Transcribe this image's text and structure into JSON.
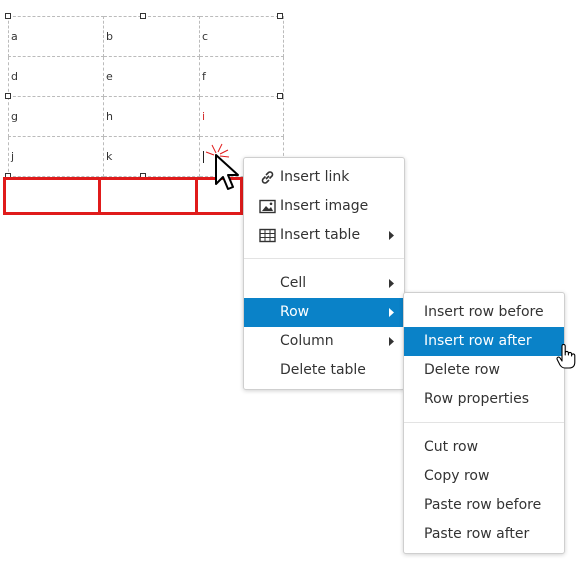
{
  "table": {
    "rows": [
      [
        "a",
        "b",
        "c"
      ],
      [
        "d",
        "e",
        "f"
      ],
      [
        "g",
        "h",
        "i"
      ],
      [
        "j",
        "k",
        ""
      ]
    ]
  },
  "context_menu": {
    "items": [
      {
        "label": "Insert link",
        "icon": "link-icon"
      },
      {
        "label": "Insert image",
        "icon": "image-icon"
      },
      {
        "label": "Insert table",
        "icon": "table-icon",
        "has_submenu": true
      },
      {
        "label": "Cell",
        "has_submenu": true
      },
      {
        "label": "Row",
        "has_submenu": true,
        "active": true
      },
      {
        "label": "Column",
        "has_submenu": true
      },
      {
        "label": "Delete table"
      }
    ]
  },
  "row_submenu": {
    "items": [
      {
        "label": "Insert row before"
      },
      {
        "label": "Insert row after",
        "active": true
      },
      {
        "label": "Delete row"
      },
      {
        "label": "Row properties"
      },
      {
        "label": "Cut row"
      },
      {
        "label": "Copy row"
      },
      {
        "label": "Paste row before"
      },
      {
        "label": "Paste row after"
      }
    ]
  },
  "colors": {
    "active_item": "#0a82c8",
    "new_row_outline": "#e01b1b",
    "cell_border": "#bbbbbb"
  }
}
